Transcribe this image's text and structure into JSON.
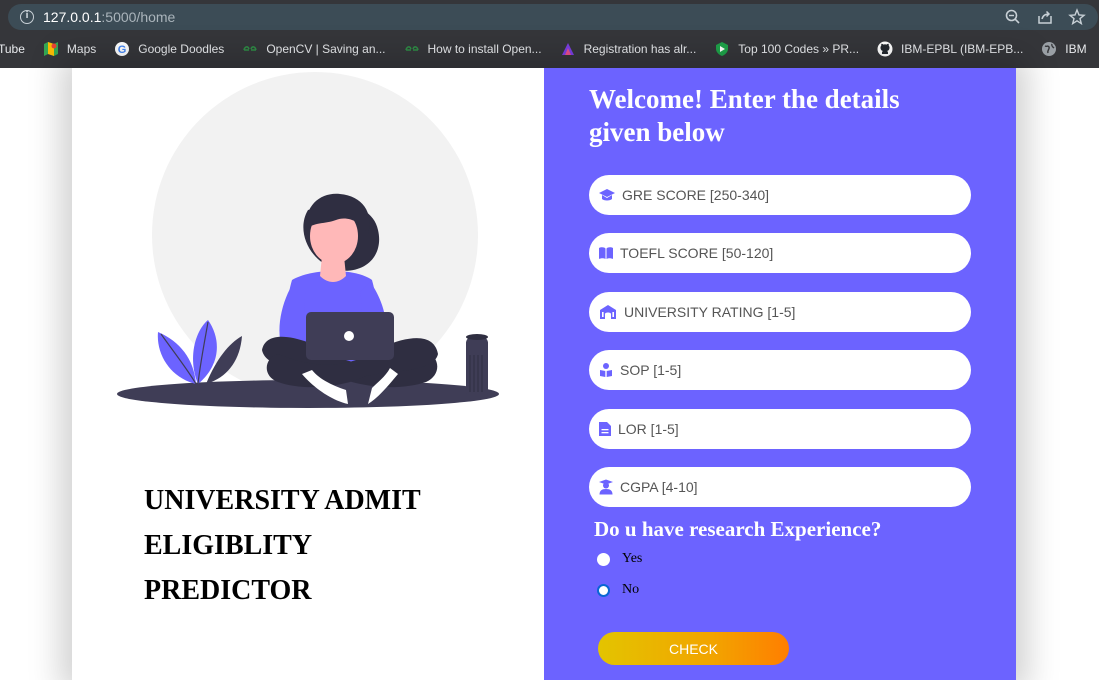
{
  "browser": {
    "url_host": "127.0.0.1",
    "url_path": ":5000/home",
    "bookmarks": [
      {
        "label": "Tube",
        "icon": "youtube-icon"
      },
      {
        "label": "Maps",
        "icon": "maps-icon"
      },
      {
        "label": "Google Doodles",
        "icon": "google-icon"
      },
      {
        "label": "OpenCV | Saving an...",
        "icon": "geeksforgeeks-icon"
      },
      {
        "label": "How to install Open...",
        "icon": "geeksforgeeks-icon"
      },
      {
        "label": "Registration has alr...",
        "icon": "registration-icon"
      },
      {
        "label": "Top 100 Codes » PR...",
        "icon": "shield-icon"
      },
      {
        "label": "IBM-EPBL (IBM-EPB...",
        "icon": "github-icon"
      },
      {
        "label": "IBM",
        "icon": "globe-icon"
      }
    ]
  },
  "left": {
    "title_line1": "UNIVERSITY ADMIT",
    "title_line2": "ELIGIBLITY",
    "title_line3": "PREDICTOR"
  },
  "form": {
    "welcome_line1": "Welcome! Enter the details",
    "welcome_line2": "given below",
    "fields": [
      {
        "placeholder": "GRE SCORE [250-340]",
        "icon": "graduation-cap-icon"
      },
      {
        "placeholder": "TOEFL SCORE [50-120]",
        "icon": "book-open-icon"
      },
      {
        "placeholder": "UNIVERSITY RATING [1-5]",
        "icon": "university-icon"
      },
      {
        "placeholder": "SOP [1-5]",
        "icon": "user-document-icon"
      },
      {
        "placeholder": "LOR [1-5]",
        "icon": "file-icon"
      },
      {
        "placeholder": "CGPA [4-10]",
        "icon": "user-graduate-icon"
      }
    ],
    "question": "Do u have research Experience?",
    "option_yes": "Yes",
    "option_no": "No",
    "selected": "No",
    "check_label": "CHECK"
  },
  "colors": {
    "panel": "#6c63ff",
    "accent_start": "#e3c400",
    "accent_end": "#ff7e00"
  }
}
